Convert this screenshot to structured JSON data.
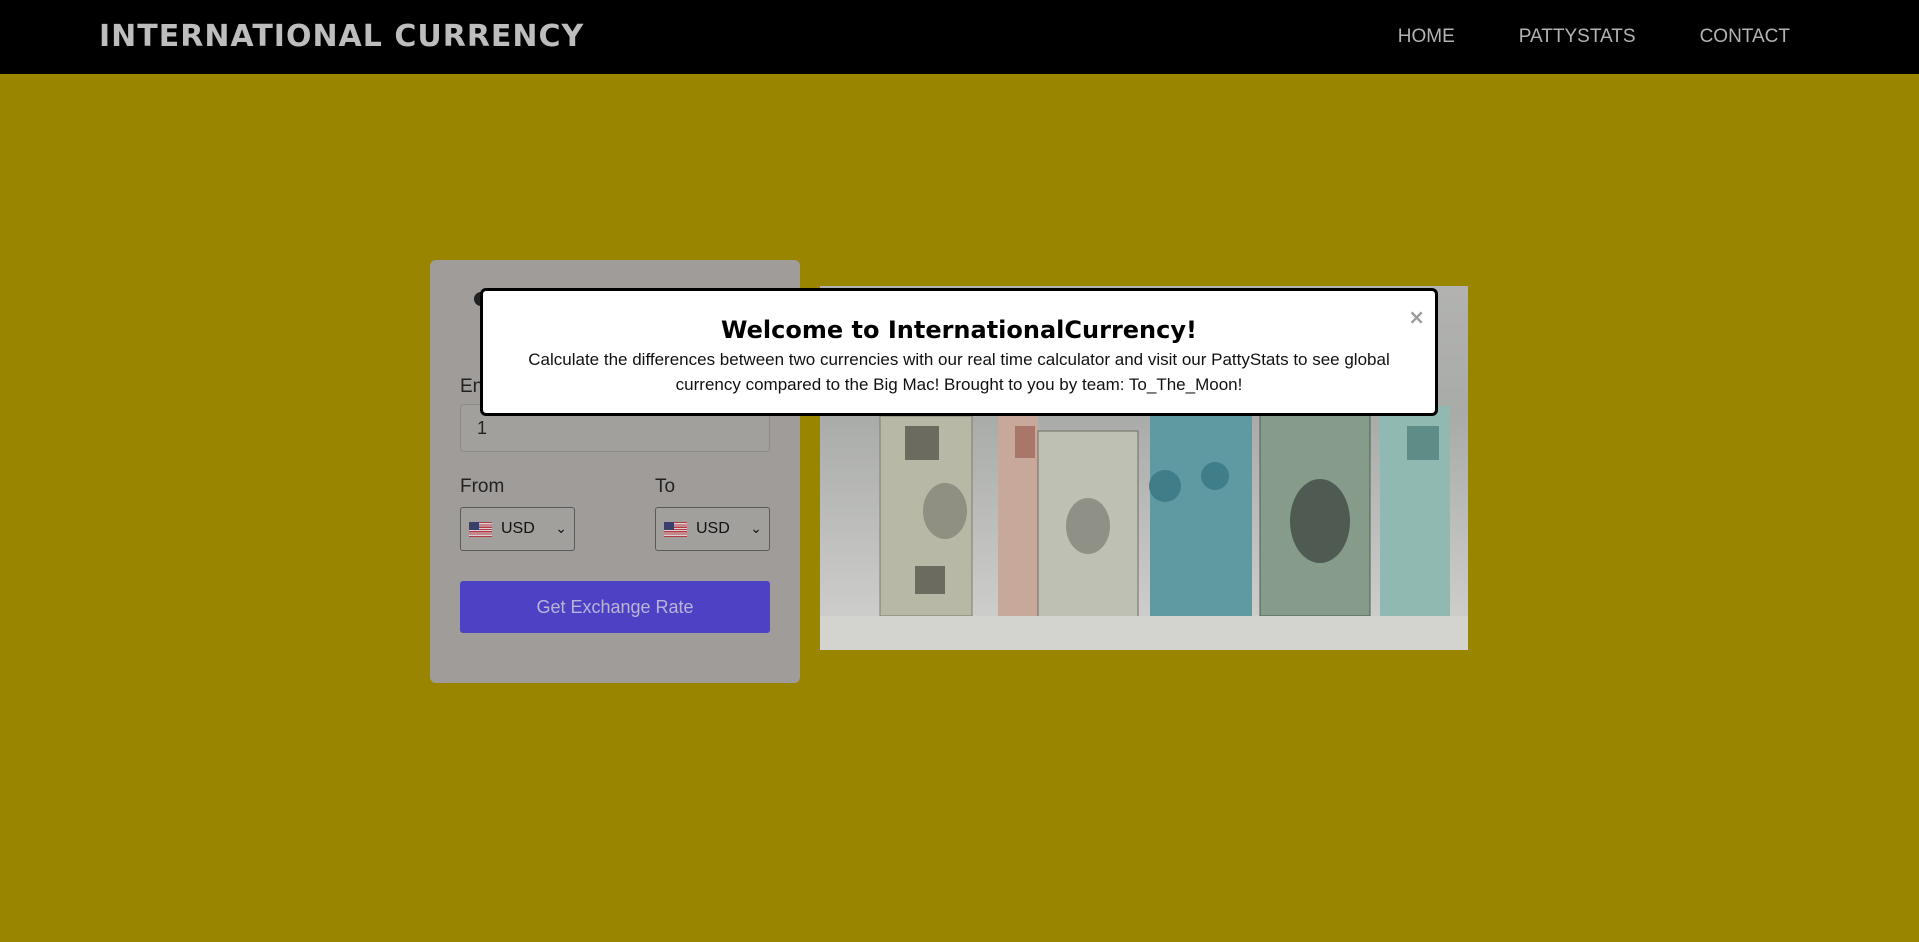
{
  "navbar": {
    "brand": "INTERNATIONAL CURRENCY",
    "links": [
      "HOME",
      "PATTYSTATS",
      "CONTACT"
    ]
  },
  "converter": {
    "amount_label_partial": "En",
    "amount_value": "1",
    "from_label": "From",
    "to_label": "To",
    "from_currency": "USD",
    "to_currency": "USD",
    "flag_icon": "us-flag-icon",
    "button_label": "Get Exchange Rate"
  },
  "image": {
    "icon": "currency-banknotes-image"
  },
  "modal": {
    "title": "Welcome to InternationalCurrency!",
    "body": "Calculate the differences between two currencies with our real time calculator and visit our PattyStats to see global currency compared to the Big Mac! Brought to you by team: To_The_Moon!",
    "close_icon": "×"
  },
  "colors": {
    "background": "#998500",
    "navbar": "#000000",
    "button": "#4d42c4",
    "card": "#9f9c9a"
  }
}
